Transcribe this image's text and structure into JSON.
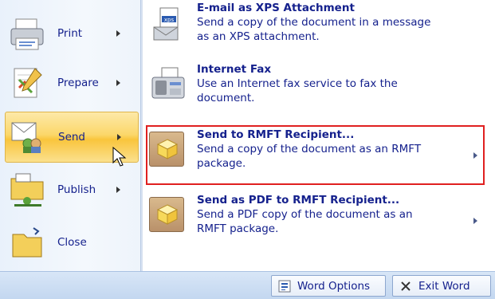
{
  "left_menu": {
    "items": [
      {
        "label": "Print",
        "icon": "printer-icon"
      },
      {
        "label": "Prepare",
        "icon": "prepare-icon"
      },
      {
        "label": "Send",
        "icon": "send-icon"
      },
      {
        "label": "Publish",
        "icon": "publish-icon"
      },
      {
        "label": "Close",
        "icon": "folder-close-icon"
      }
    ]
  },
  "send_menu": {
    "items": [
      {
        "title": "E-mail as XPS Attachment",
        "desc_1": "Send a copy of the document in a message",
        "desc_2": "as an XPS attachment.",
        "icon": "xps-email-icon"
      },
      {
        "title": "Internet Fax",
        "desc_1": "Use an Internet fax service to fax the",
        "desc_2": "document.",
        "icon": "fax-icon"
      },
      {
        "title": "Send to RMFT Recipient...",
        "desc_1": "Send a copy of the document as an RMFT",
        "desc_2": "package.",
        "icon": "rmft-package-icon"
      },
      {
        "title": "Send as PDF to RMFT Recipient...",
        "desc_1": "Send a PDF copy of the document as an",
        "desc_2": "RMFT package.",
        "icon": "rmft-package-icon"
      }
    ]
  },
  "footer": {
    "word_options": "Word Options",
    "exit_word": "Exit Word"
  },
  "colors": {
    "text": "#15218d",
    "highlight_border": "#e02020",
    "selected_gradient_top": "#fde9a8",
    "selected_gradient_bottom": "#f9c53c"
  }
}
